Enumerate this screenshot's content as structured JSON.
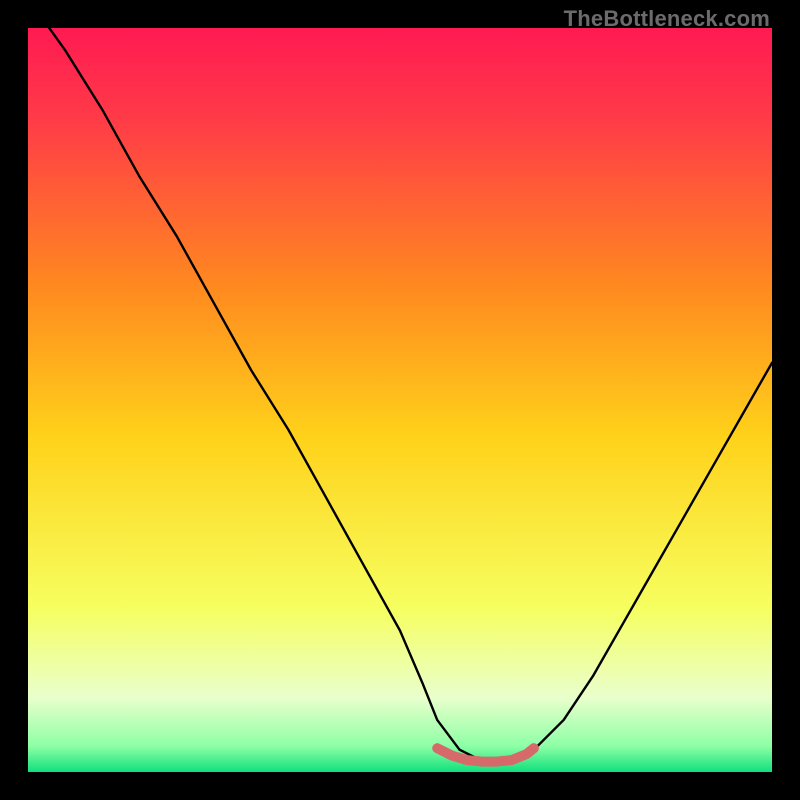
{
  "watermark": {
    "text": "TheBottleneck.com"
  },
  "colors": {
    "top": "#ff1a52",
    "upper": "#ff5a2a",
    "mid": "#ffd21a",
    "lower": "#f6ff60",
    "pale": "#e9ffcc",
    "bottom": "#11e07c",
    "curve": "#000000",
    "accent": "#d66a6a",
    "frame": "#000000"
  },
  "chart_data": {
    "type": "line",
    "title": "",
    "xlabel": "",
    "ylabel": "",
    "xlim": [
      0,
      100
    ],
    "ylim": [
      0,
      100
    ],
    "grid": false,
    "legend": false,
    "annotations": [],
    "series": [
      {
        "name": "bottleneck-curve",
        "x": [
          0,
          5,
          10,
          15,
          20,
          25,
          30,
          35,
          40,
          45,
          50,
          53,
          55,
          58,
          61,
          63,
          65,
          68,
          72,
          76,
          80,
          84,
          88,
          92,
          96,
          100
        ],
        "y": [
          104,
          97,
          89,
          80,
          72,
          63,
          54,
          46,
          37,
          28,
          19,
          12,
          7,
          3,
          1.5,
          1.2,
          1.5,
          3,
          7,
          13,
          20,
          27,
          34,
          41,
          48,
          55
        ]
      },
      {
        "name": "minimum-highlight",
        "x": [
          55,
          57,
          59,
          61,
          63,
          65,
          67,
          68
        ],
        "y": [
          3.2,
          2.2,
          1.6,
          1.4,
          1.4,
          1.6,
          2.4,
          3.2
        ]
      }
    ],
    "gradient_stops": [
      {
        "pos": 0.0,
        "color": "#ff1a52"
      },
      {
        "pos": 0.12,
        "color": "#ff3a48"
      },
      {
        "pos": 0.35,
        "color": "#ff8a1f"
      },
      {
        "pos": 0.55,
        "color": "#ffd21a"
      },
      {
        "pos": 0.78,
        "color": "#f6ff60"
      },
      {
        "pos": 0.9,
        "color": "#e9ffcc"
      },
      {
        "pos": 0.965,
        "color": "#8effa6"
      },
      {
        "pos": 1.0,
        "color": "#11e07c"
      }
    ]
  }
}
